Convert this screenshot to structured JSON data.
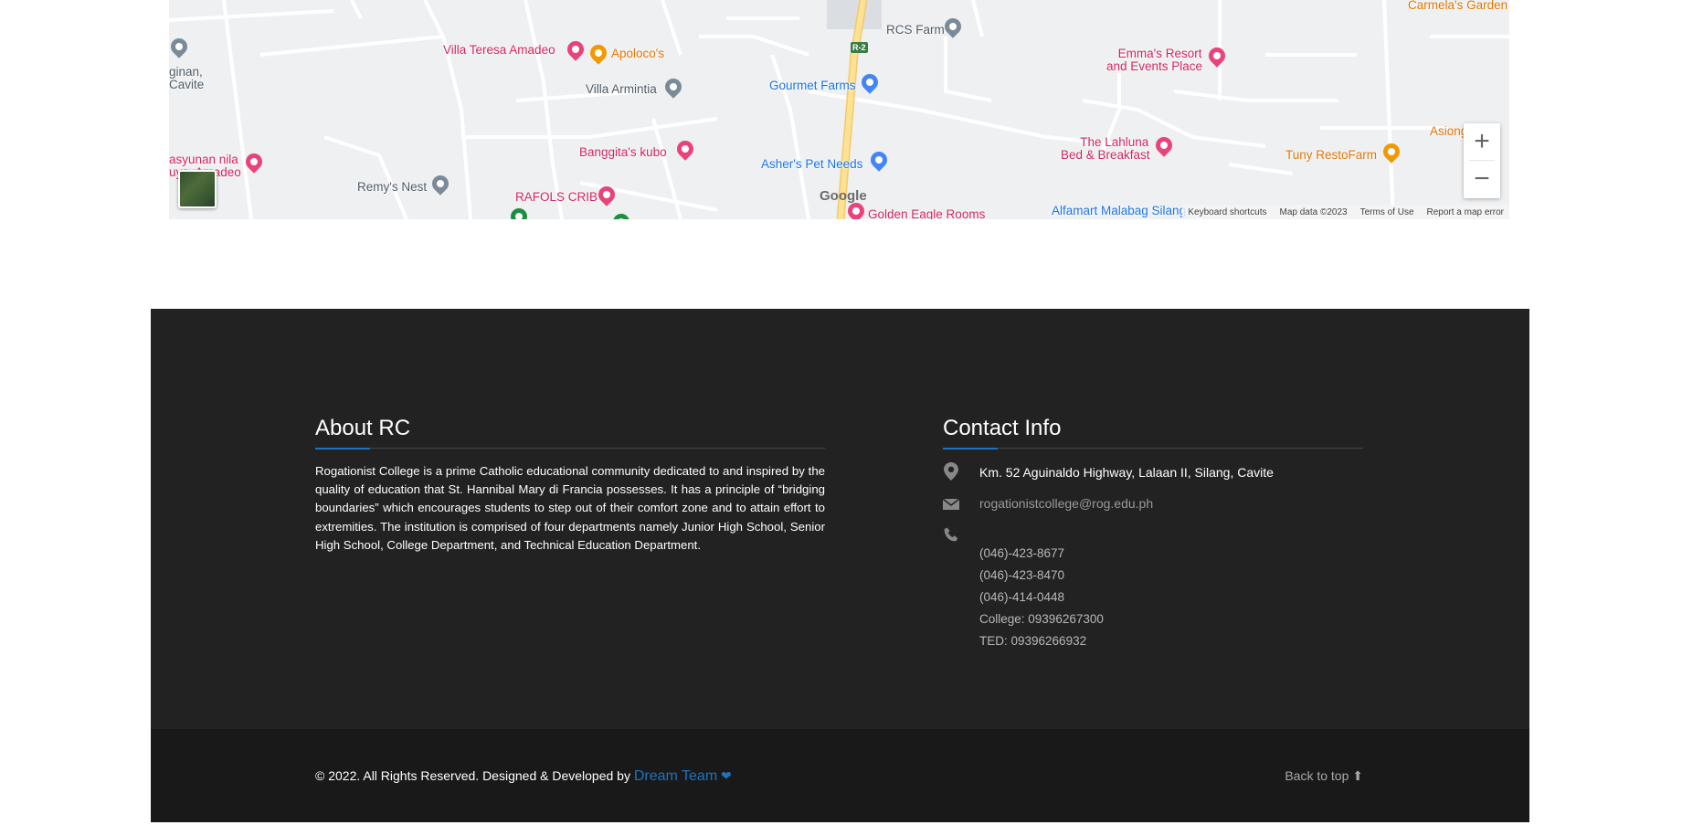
{
  "map": {
    "places": [
      {
        "name": "Villa Teresa Amadeo",
        "kind": "red"
      },
      {
        "name": "Apoloco's",
        "kind": "orange"
      },
      {
        "name": "Villa Armintia",
        "kind": "gray"
      },
      {
        "name": "Gourmet Farms",
        "kind": "blue"
      },
      {
        "name": "RCS Farm",
        "kind": "gray"
      },
      {
        "name": "Emma's Resort",
        "kind": "red"
      },
      {
        "name": "and Events Place",
        "kind": "red"
      },
      {
        "name": "Banggita's kubo",
        "kind": "red"
      },
      {
        "name": "Asher's Pet Needs",
        "kind": "blue"
      },
      {
        "name": "The Lahluna",
        "kind": "red"
      },
      {
        "name": "Bed & Breakfast",
        "kind": "red"
      },
      {
        "name": "Tuny RestoFarm",
        "kind": "orange"
      },
      {
        "name": "Asiong",
        "kind": "orange"
      },
      {
        "name": "Remy's Nest",
        "kind": "gray"
      },
      {
        "name": "RAFOLS CRIB",
        "kind": "red"
      },
      {
        "name": "Golden Eagle Rooms",
        "kind": "red"
      },
      {
        "name": "Alfamart Malabag Silang",
        "kind": "blue"
      },
      {
        "name": "Carmela's Garden C",
        "kind": "orange"
      },
      {
        "name": "ginan,",
        "kind": "gray"
      },
      {
        "name": "Cavite",
        "kind": "gray"
      },
      {
        "name": "asyunan nila",
        "kind": "red"
      },
      {
        "name": "uya, Amadeo",
        "kind": "red"
      }
    ],
    "route_label": "R-2",
    "google_mark": "Google",
    "zoom_in": "+",
    "zoom_out": "−",
    "footer_links": [
      "Keyboard shortcuts",
      "Map data ©2023",
      "Terms of Use",
      "Report a map error"
    ]
  },
  "about": {
    "title": "About RC",
    "text": "Rogationist College is a prime Catholic educational community dedicated to and inspired by the quality of education that St. Hannibal Mary di Francia possesses. It has a principle of “bridging boundaries” which encourages students to step out of their comfort zone and to attain effort to extremities. The institution is comprised of four departments namely Junior High School, Senior High School, College Department, and Technical Education Department."
  },
  "contact": {
    "title": "Contact Info",
    "address": "Km. 52 Aguinaldo Highway, Lalaan II, Silang, Cavite",
    "email": "rogationistcollege@rog.edu.ph",
    "phones": [
      "(046)-423-8677",
      "(046)-423-8470",
      "(046)-414-0448",
      "College: 09396267300",
      "TED: 09396266932"
    ]
  },
  "bottom": {
    "copyright": "© 2022. All Rights Reserved. Designed & Developed by",
    "team": "Dream Team",
    "back_to_top": "Back to top"
  },
  "colors": {
    "footer_bg": "#222222",
    "bottombar_bg": "#191919",
    "accent": "#1e73be"
  }
}
